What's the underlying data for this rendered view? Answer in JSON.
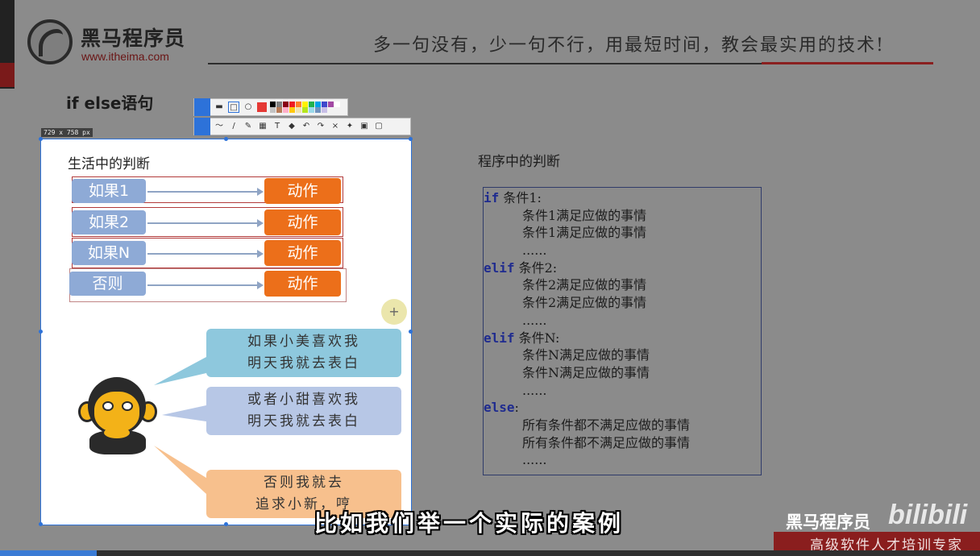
{
  "header": {
    "brand_name": "黑马程序员",
    "brand_url": "www.itheima.com",
    "slogan": "多一句没有，少一句不行，用最短时间，教会最实用的技术!"
  },
  "slide": {
    "title": "if else语句"
  },
  "capture": {
    "size_label": "729 x 758 px",
    "life_title": "生活中的判断",
    "conditions": [
      "如果1",
      "如果2",
      "如果N",
      "否则"
    ],
    "action_label": "动作",
    "bubbles": [
      [
        "如果小美喜欢我",
        "明天我就去表白"
      ],
      [
        "或者小甜喜欢我",
        "明天我就去表白"
      ],
      [
        "否则我就去",
        "追求小新，哼"
      ]
    ],
    "crosshair_symbol": "+"
  },
  "program": {
    "title": "程序中的判断",
    "lines": [
      {
        "kw": "if",
        "text": " 条件1:",
        "indent": false
      },
      {
        "kw": "",
        "text": "条件1满足应做的事情",
        "indent": true
      },
      {
        "kw": "",
        "text": "条件1满足应做的事情",
        "indent": true
      },
      {
        "kw": "",
        "text": "......",
        "indent": true
      },
      {
        "kw": "elif",
        "text": " 条件2:",
        "indent": false
      },
      {
        "kw": "",
        "text": "条件2满足应做的事情",
        "indent": true
      },
      {
        "kw": "",
        "text": "条件2满足应做的事情",
        "indent": true
      },
      {
        "kw": "",
        "text": "......",
        "indent": true
      },
      {
        "kw": "elif",
        "text": " 条件N:",
        "indent": false
      },
      {
        "kw": "",
        "text": "条件N满足应做的事情",
        "indent": true
      },
      {
        "kw": "",
        "text": "条件N满足应做的事情",
        "indent": true
      },
      {
        "kw": "",
        "text": "......",
        "indent": true
      },
      {
        "kw": "else",
        "text": ":",
        "indent": false
      },
      {
        "kw": "",
        "text": "所有条件都不满足应做的事情",
        "indent": true
      },
      {
        "kw": "",
        "text": "所有条件都不满足应做的事情",
        "indent": true
      },
      {
        "kw": "",
        "text": "......",
        "indent": true
      }
    ]
  },
  "subtitle": "比如我们举一个实际的案例",
  "watermark": {
    "name": "黑马程序员",
    "platform": "bilibili",
    "tagline": "高级软件人才培训专家"
  },
  "toolbar": {
    "row1_icons": [
      "rect-select-icon",
      "rectangle-icon",
      "ellipse-icon"
    ],
    "row2_icons": [
      "pen-icon",
      "pencil-icon",
      "marker-icon",
      "mosaic-icon",
      "text-icon",
      "eraser-icon",
      "undo-icon",
      "redo-icon",
      "close-icon",
      "pin-icon",
      "save-icon",
      "copy-icon"
    ],
    "row2_glyphs": [
      "〜",
      "/",
      "✎",
      "▦",
      "T",
      "◆",
      "↶",
      "↷",
      "×",
      "✦",
      "▣",
      "▢"
    ],
    "active_color": "#e53935",
    "palette": [
      "#000000",
      "#7f7f7f",
      "#880015",
      "#ed1c24",
      "#ff7f27",
      "#fff200",
      "#22b14c",
      "#00a2e8",
      "#3f48cc",
      "#a349a4",
      "#ffffff",
      "#c3c3c3",
      "#b97a57",
      "#ffaec9",
      "#ffc90e",
      "#efe4b0",
      "#b5e61d",
      "#99d9ea",
      "#7092be",
      "#c8bfe7"
    ]
  },
  "colors": {
    "condition_blue": "#8eaad6",
    "action_orange": "#ec6f1a",
    "keyword_blue": "#1f2b8f",
    "selection_blue": "#2d72d9"
  }
}
